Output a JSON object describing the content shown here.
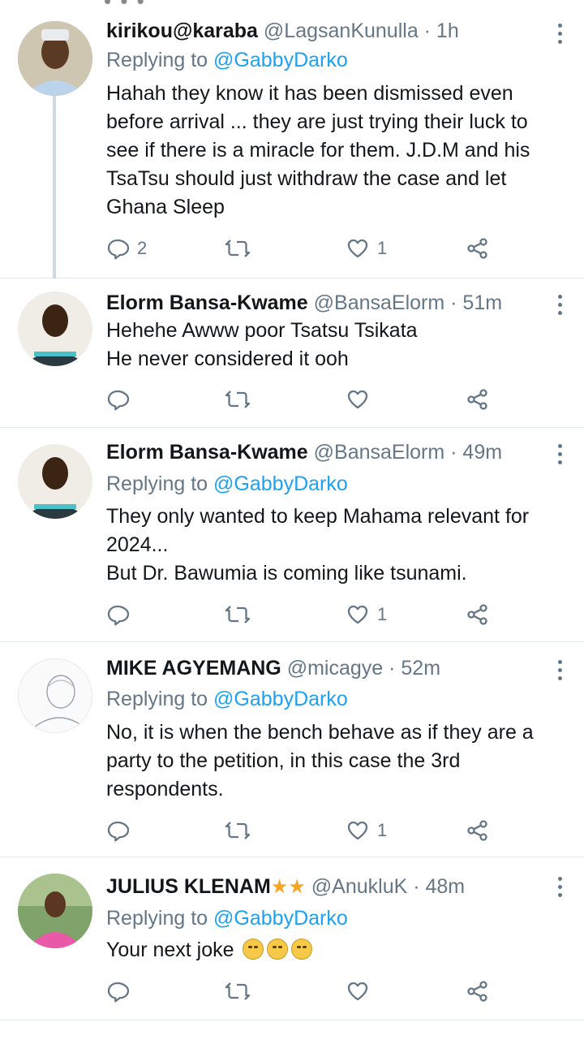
{
  "tweets": [
    {
      "name": "kirikou@karaba",
      "handle": "@LagsanKunulla · 1h",
      "replying_prefix": "Replying to ",
      "replying_to": "@GabbyDarko",
      "body": "Hahah they  know it has been dismissed even before arrival ... they are just trying their luck to see if there is a miracle for them. J.D.M  and his TsaTsu should just withdraw the case and let Ghana Sleep",
      "replies": "2",
      "retweets": "",
      "likes": "1"
    },
    {
      "name": "Elorm Bansa-Kwame",
      "handle": "@BansaElorm · 51m",
      "body_lines": [
        "Hehehe Awww poor Tsatsu Tsikata",
        "He never considered it ooh"
      ],
      "replies": "",
      "retweets": "",
      "likes": ""
    },
    {
      "name": "Elorm Bansa-Kwame",
      "handle": "@BansaElorm · 49m",
      "replying_prefix": "Replying to ",
      "replying_to": "@GabbyDarko",
      "body_lines": [
        "They only wanted to keep Mahama relevant for",
        "2024...",
        "But Dr. Bawumia is coming like tsunami."
      ],
      "replies": "",
      "retweets": "",
      "likes": "1"
    },
    {
      "name": "MIKE AGYEMANG",
      "handle": "@micagye · 52m",
      "replying_prefix": "Replying to ",
      "replying_to": "@GabbyDarko",
      "body": "No, it is when the bench behave as if they are a party to the petition, in this case the 3rd respondents.",
      "replies": "",
      "retweets": "",
      "likes": "1"
    },
    {
      "name": "JULIUS KLENAM",
      "name_stars": "★★",
      "handle": "@AnukluK · 48m",
      "replying_prefix": "Replying to ",
      "replying_to": "@GabbyDarko",
      "body": "Your next joke",
      "body_emoji": [
        "face-with-rolling-eyes-emoji",
        "face-with-rolling-eyes-emoji",
        "face-with-rolling-eyes-emoji"
      ],
      "replies": "",
      "retweets": "",
      "likes": ""
    }
  ],
  "colors": {
    "link": "#1da1f2",
    "secondary": "#657786",
    "text": "#14171a",
    "divider": "#e1e8ed"
  }
}
